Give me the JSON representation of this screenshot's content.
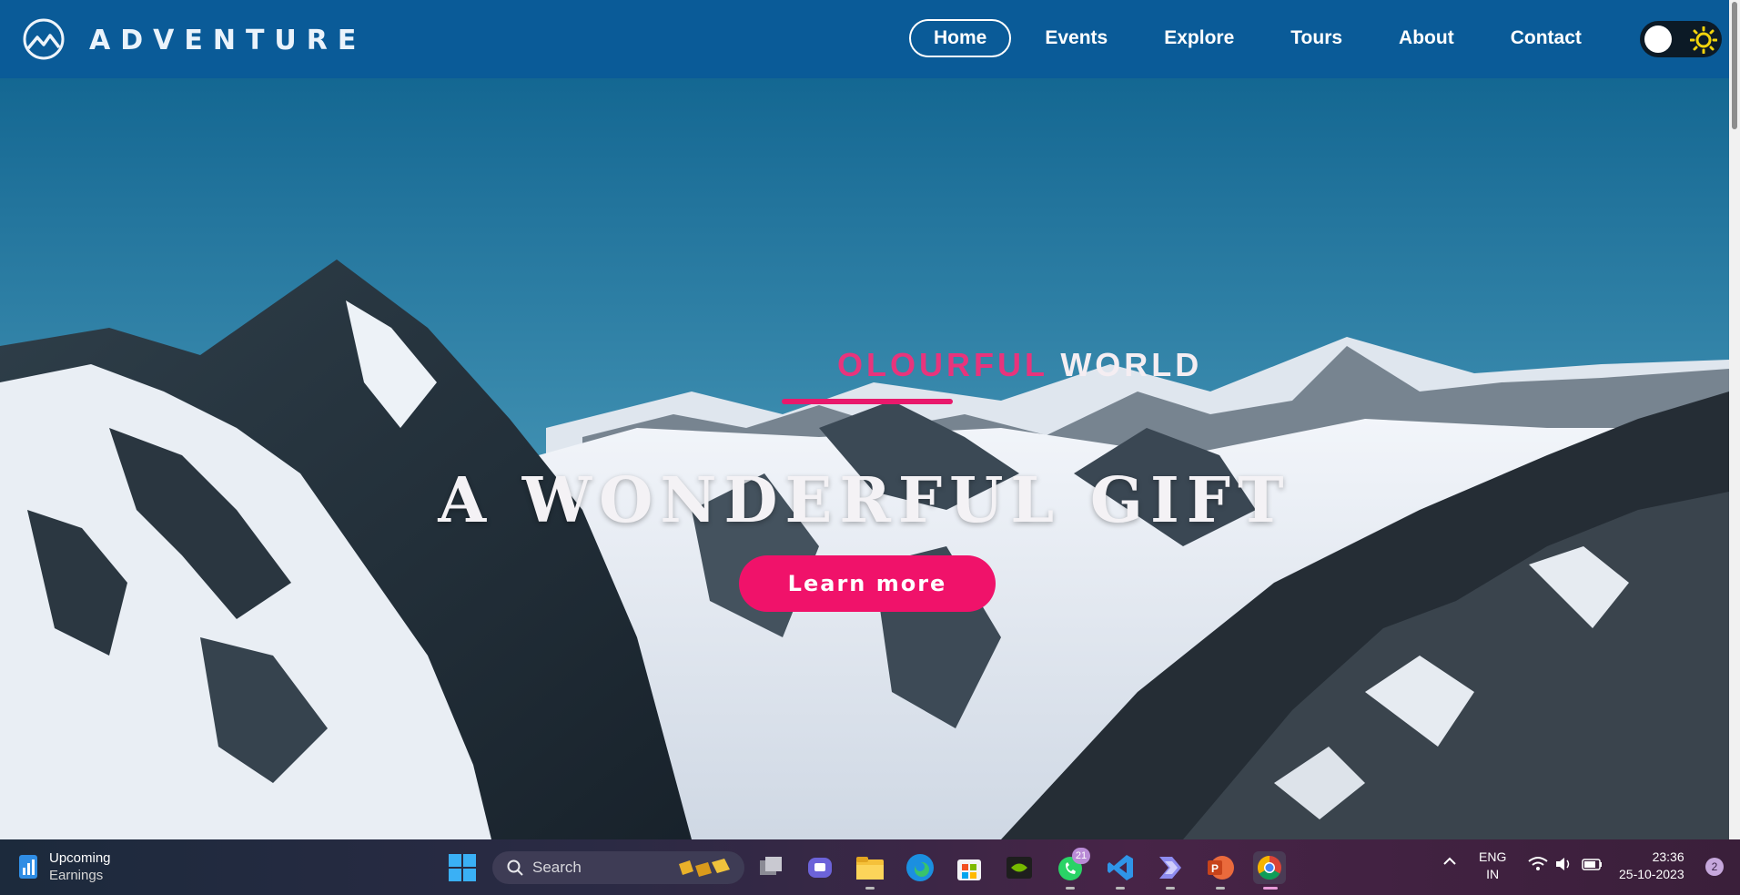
{
  "brand": {
    "name": "ADVENTURE"
  },
  "nav": {
    "items": [
      "Home",
      "Events",
      "Explore",
      "Tours",
      "About",
      "Contact"
    ],
    "active": "Home"
  },
  "hero": {
    "tagline_pink": "OLOURFUL ",
    "tagline_white": "WORLD",
    "headline": "A WONDERFUL GIFT",
    "cta_label": "Learn more"
  },
  "colors": {
    "navbar": "#0a5b98",
    "accent": "#f0126a",
    "sun": "#f2d40c"
  },
  "taskbar": {
    "widget_title": "Upcoming",
    "widget_sub": "Earnings",
    "search_placeholder": "Search",
    "whatsapp_badge": "21",
    "language": "ENG",
    "region": "IN",
    "time": "23:36",
    "date": "25-10-2023",
    "notification_count": "2"
  }
}
